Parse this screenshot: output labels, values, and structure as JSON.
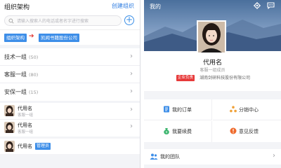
{
  "left": {
    "title": "组织架构",
    "create_link": "创建组织",
    "search_placeholder": "请输入搜索人的电话或者名字进行搜索",
    "breadcrumb": [
      "组织架构",
      "凯闻书籍股份公司"
    ],
    "groups": [
      {
        "name": "技术一组",
        "count": "(50)"
      },
      {
        "name": "客服一组",
        "count": "(80)"
      },
      {
        "name": "安保一组",
        "count": "(15)"
      }
    ],
    "members": [
      {
        "name": "代用名",
        "role": "客服一组"
      },
      {
        "name": "代用名",
        "role": "客服一组"
      }
    ],
    "admin_member": {
      "name": "代用名",
      "badge": "管理员"
    }
  },
  "right": {
    "title": "我的",
    "profile": {
      "name": "代用名",
      "role": "客服一组成员",
      "badge": "企业负责",
      "company": "湖南剑研科技股份有限公司"
    },
    "menu": [
      {
        "label": "我的订单",
        "icon": "order-icon",
        "color": "#3d8ee8"
      },
      {
        "label": "分销中心",
        "icon": "distribution-icon",
        "color": "#f0a23a"
      },
      {
        "label": "我要续费",
        "icon": "renew-icon",
        "color": "#3bb56d"
      },
      {
        "label": "意见反馈",
        "icon": "feedback-icon",
        "color": "#ef6a2c"
      }
    ],
    "team": {
      "label": "我的团队",
      "icon": "team-icon"
    }
  },
  "colors": {
    "accent": "#3d8ee8",
    "link": "#2f7de1",
    "badge_red": "#e73a3a"
  }
}
